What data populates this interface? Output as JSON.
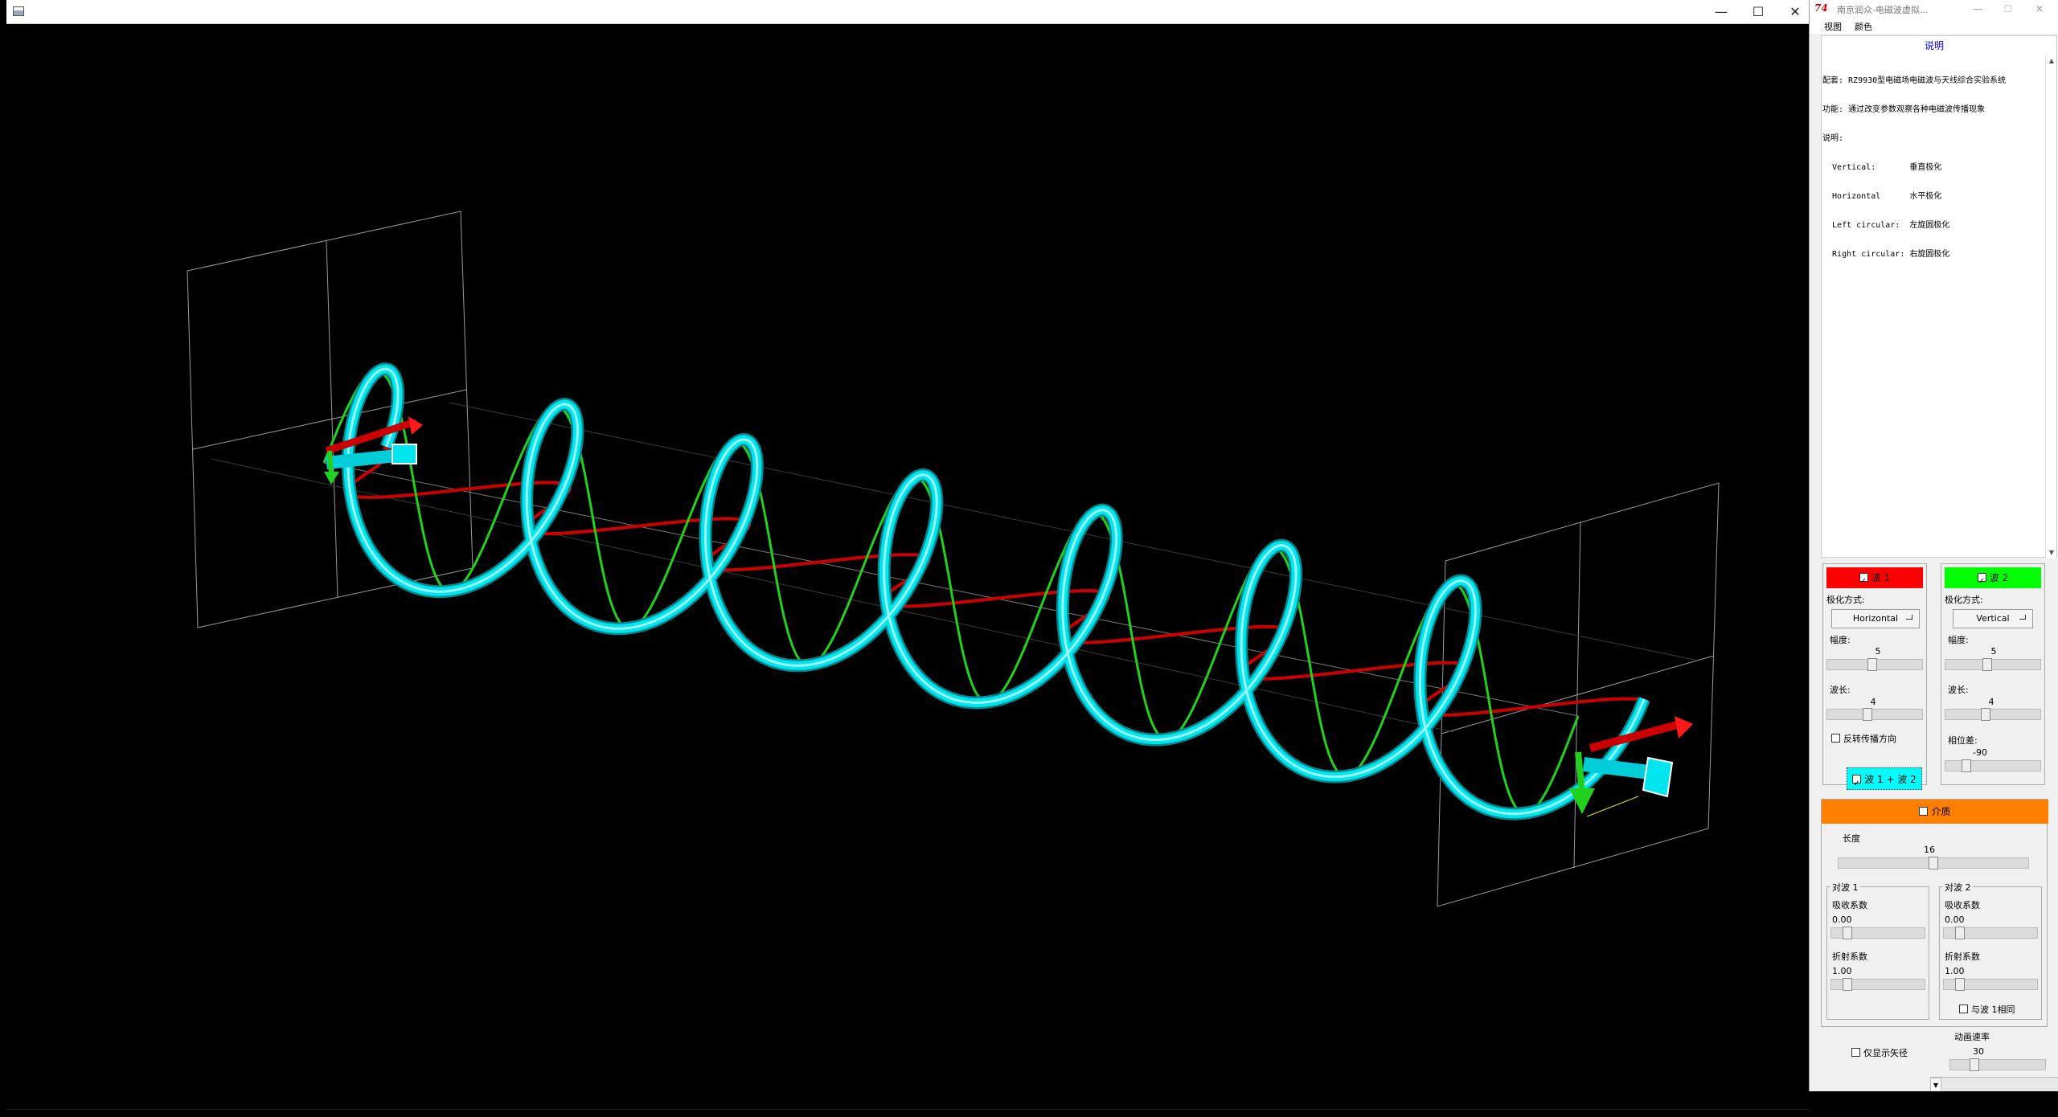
{
  "viewer": {
    "window_controls": {
      "minimize": "—",
      "maximize": "☐",
      "close": "✕"
    }
  },
  "panel": {
    "logo": "74",
    "title": "南京润众-电磁波虚拟...",
    "window_controls": {
      "minimize": "—",
      "maximize": "☐",
      "close": "✕"
    },
    "menu": {
      "view": "视图",
      "color": "颜色"
    },
    "info": {
      "header": "说明",
      "lines": [
        "配套: RZ9930型电磁场电磁波与天线综合实验系统",
        "功能: 通过改变参数观察各种电磁波传播现象",
        "说明:",
        "  Vertical:       垂直极化",
        "  Horizontal      水平极化",
        "  Left circular:  左旋圆极化",
        "  Right circular: 右旋圆极化"
      ]
    },
    "wave1": {
      "header": "波 1",
      "checked": true,
      "color": "#ff0000",
      "polarization_label": "极化方式:",
      "polarization": "Horizontal",
      "amplitude_label": "幅度:",
      "amplitude": "5",
      "wavelength_label": "波长:",
      "wavelength": "4",
      "reverse_label": "反转传播方向",
      "reverse_checked": false
    },
    "wave2": {
      "header": "波 2",
      "checked": true,
      "color": "#00ff00",
      "polarization_label": "极化方式:",
      "polarization": "Vertical",
      "amplitude_label": "幅度:",
      "amplitude": "5",
      "wavelength_label": "波长:",
      "wavelength": "4",
      "phase_label": "相位差:",
      "phase": "-90"
    },
    "sum_button": {
      "label": "波 1 + 波 2",
      "checked": true,
      "color": "#00ffff"
    },
    "medium": {
      "header": "介质",
      "checked": false,
      "color": "#ff8000",
      "length_label": "长度",
      "length": "16",
      "for_wave1": {
        "title": "对波 1",
        "absorption_label": "吸收系数",
        "absorption": "0.00",
        "refraction_label": "折射系数",
        "refraction": "1.00"
      },
      "for_wave2": {
        "title": "对波 2",
        "absorption_label": "吸收系数",
        "absorption": "0.00",
        "refraction_label": "折射系数",
        "refraction": "1.00",
        "same_as_wave1_label": "与波 1相同",
        "same_as_wave1_checked": false
      }
    },
    "vector_only": {
      "label": "仅显示矢径",
      "checked": false
    },
    "animation": {
      "label": "动画速率",
      "value": "30"
    }
  },
  "scene": {
    "colors": {
      "helix": "#00e5ee",
      "wave_vertical": "#22d11d",
      "wave_horizontal": "#cc0000",
      "frame": "#9a9a9a",
      "axis": "#808080"
    },
    "turns": 7
  }
}
